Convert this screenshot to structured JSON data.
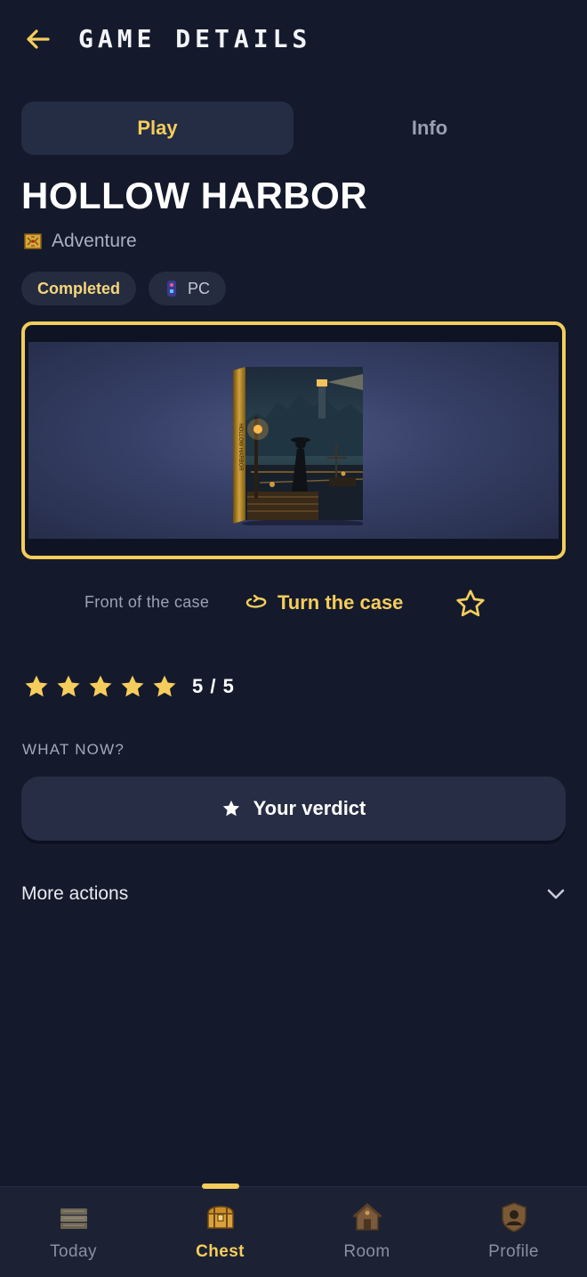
{
  "header": {
    "title": "GAME DETAILS"
  },
  "tabs": [
    {
      "label": "Play",
      "active": true
    },
    {
      "label": "Info",
      "active": false
    }
  ],
  "game": {
    "title": "HOLLOW HARBOR",
    "genre": "Adventure",
    "genre_icon": "treasure-map-icon",
    "status": "Completed",
    "platform": "PC",
    "platform_icon": "gamepad-icon"
  },
  "cover": {
    "box_spine_text": "HOLLOW HARBOR"
  },
  "case_controls": {
    "side_label": "Front of the case",
    "turn_label": "Turn the case",
    "turn_icon": "rotate-icon",
    "favorite_icon": "star-outline-icon"
  },
  "rating": {
    "value": 5,
    "max": 5,
    "text": "5 / 5"
  },
  "what_now": {
    "label": "WHAT NOW?",
    "verdict_button": "Your verdict"
  },
  "more_actions": {
    "label": "More actions"
  },
  "nav": [
    {
      "label": "Today",
      "icon": "books-icon",
      "active": false
    },
    {
      "label": "Chest",
      "icon": "chest-icon",
      "active": true
    },
    {
      "label": "Room",
      "icon": "house-icon",
      "active": false
    },
    {
      "label": "Profile",
      "icon": "profile-badge-icon",
      "active": false
    }
  ],
  "colors": {
    "background": "#141a2c",
    "accent": "#f5cd5c",
    "surface": "#262d44",
    "muted_text": "#9ca2b4"
  }
}
